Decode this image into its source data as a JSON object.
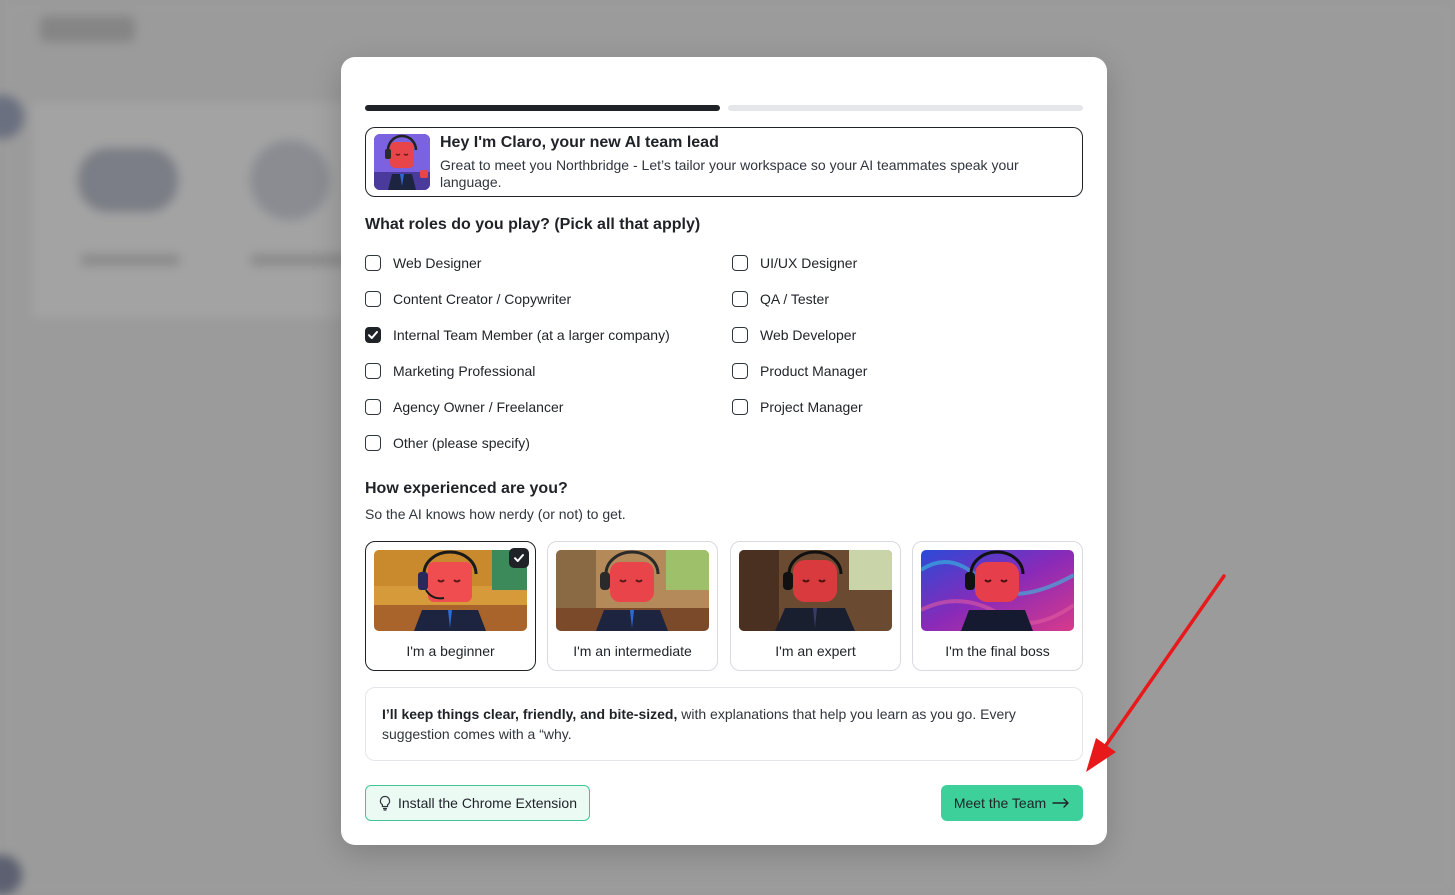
{
  "onboarding": {
    "progress": {
      "step": 1,
      "total": 2
    },
    "intro": {
      "title": "Hey I'm Claro, your new AI team lead",
      "subtitle": "Great to meet you Northbridge - Let’s tailor your workspace so your AI teammates speak your language."
    },
    "roles_question": "What roles do you play? (Pick all that apply)",
    "roles": [
      {
        "label": "Web Designer",
        "checked": false
      },
      {
        "label": "UI/UX Designer",
        "checked": false
      },
      {
        "label": "Content Creator / Copywriter",
        "checked": false
      },
      {
        "label": "QA / Tester",
        "checked": false
      },
      {
        "label": "Internal Team Member (at a larger company)",
        "checked": true
      },
      {
        "label": "Web Developer",
        "checked": false
      },
      {
        "label": "Marketing Professional",
        "checked": false
      },
      {
        "label": "Product Manager",
        "checked": false
      },
      {
        "label": "Agency Owner / Freelancer",
        "checked": false
      },
      {
        "label": "Project Manager",
        "checked": false
      },
      {
        "label": "Other (please specify)",
        "checked": false
      }
    ],
    "experience_question": "How experienced are you?",
    "experience_subtitle": "So the AI knows how nerdy (or not) to get.",
    "levels": [
      {
        "label": "I'm a beginner",
        "selected": true
      },
      {
        "label": "I'm an intermediate",
        "selected": false
      },
      {
        "label": "I'm an expert",
        "selected": false
      },
      {
        "label": "I'm the final boss",
        "selected": false
      }
    ],
    "note": {
      "bold": "I’ll keep things clear, friendly, and bite-sized,",
      "rest": " with explanations that help you learn as you go. Every suggestion comes with a “why."
    },
    "extension_button": "Install the Chrome Extension",
    "team_button": "Meet the Team",
    "icons": {
      "extension": "lightbulb-icon",
      "team": "arrow-right-icon",
      "check": "check-icon"
    },
    "colors": {
      "accent_green": "#3ed09a",
      "dark": "#1f2328",
      "annotation_red": "#e8191a"
    }
  }
}
